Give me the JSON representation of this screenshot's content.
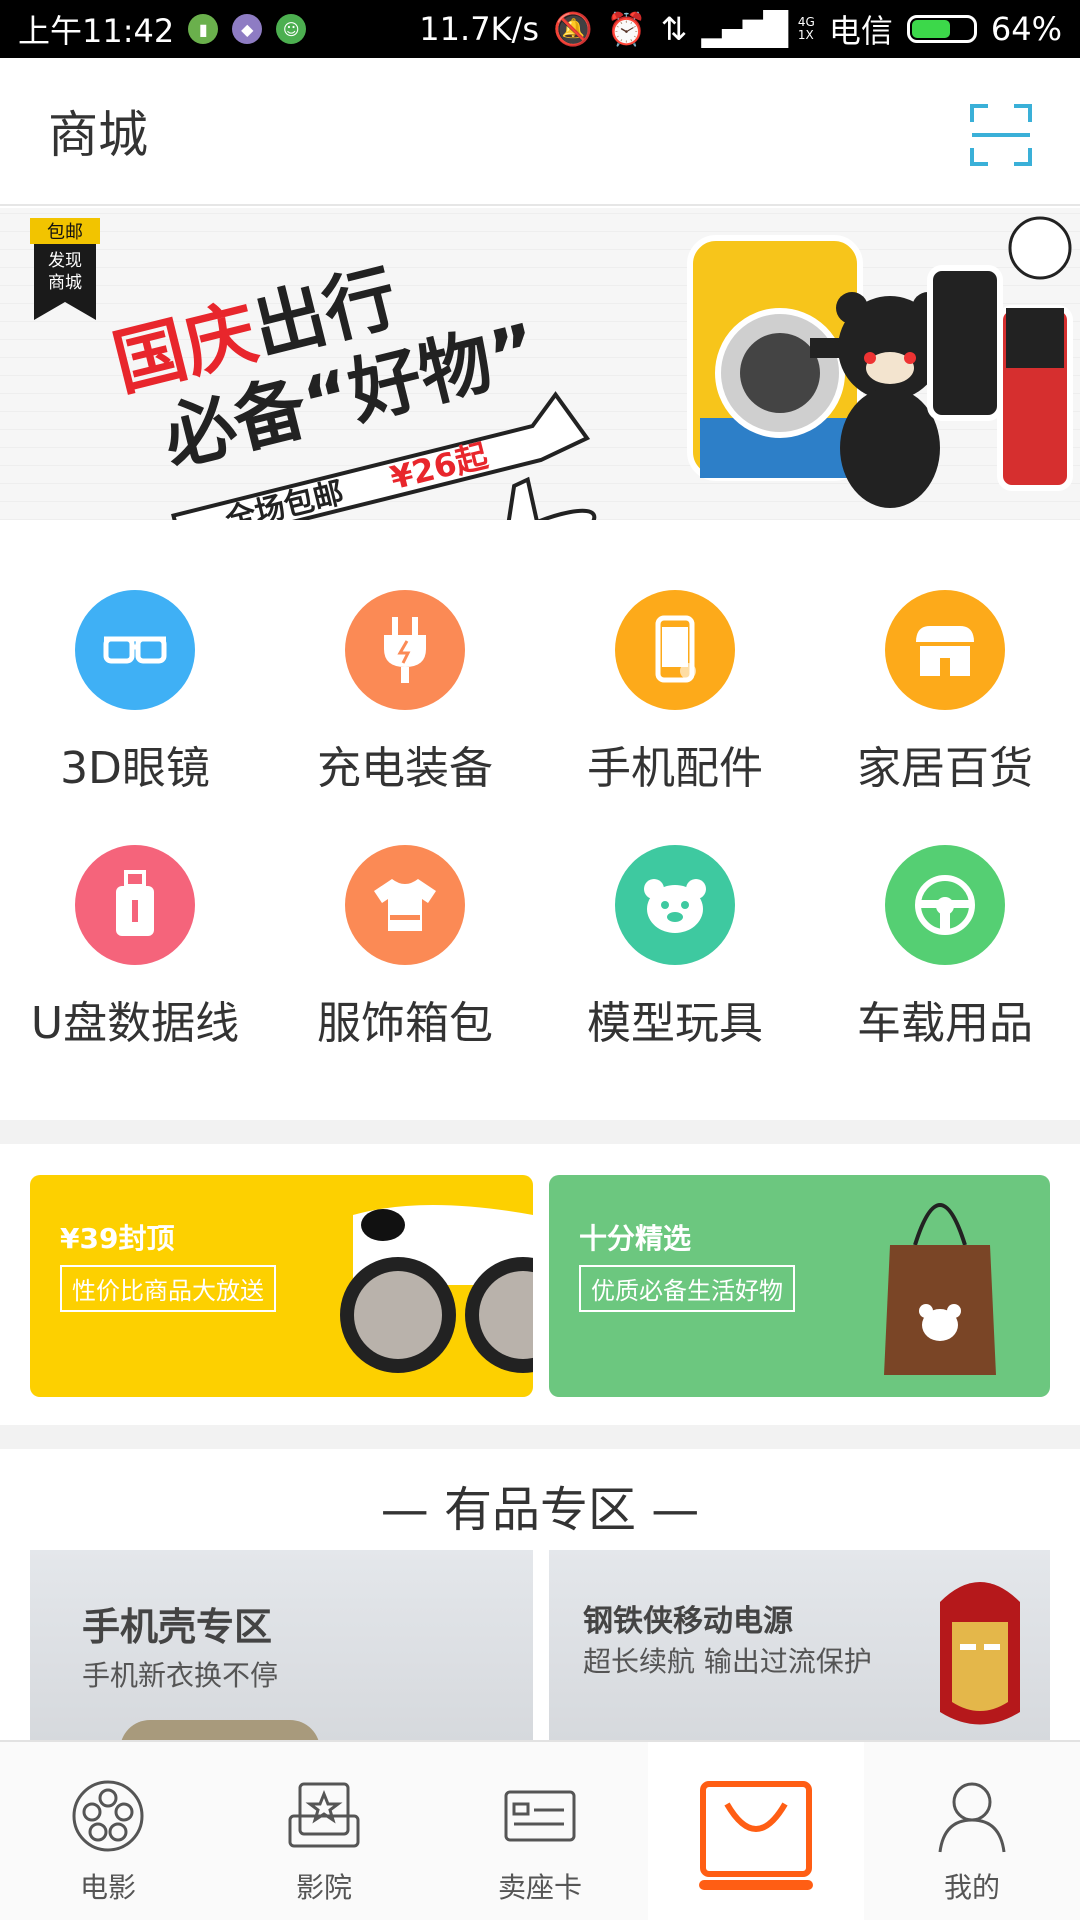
{
  "status_bar": {
    "time": "上午11:42",
    "net_speed": "11.7K/s",
    "network_small": "4G\n1X",
    "carrier": "电信",
    "battery": "64%",
    "battery_level": 0.64
  },
  "header": {
    "title": "商城",
    "scan_icon": "scan-icon"
  },
  "banner": {
    "tag_top": "包邮",
    "tag_line1": "发现",
    "tag_line2": "商城",
    "headline_red": "国庆",
    "headline_rest": "出行",
    "headline_line2": "必备“好物”",
    "ribbon_text": "全场包邮",
    "price_text": "¥26起"
  },
  "categories": [
    {
      "label": "3D眼镜",
      "icon": "3d-glasses-icon",
      "color": "#3fb0f5"
    },
    {
      "label": "充电装备",
      "icon": "plug-icon",
      "color": "#fb8a55"
    },
    {
      "label": "手机配件",
      "icon": "phone-icon",
      "color": "#fdaa1a"
    },
    {
      "label": "家居百货",
      "icon": "store-icon",
      "color": "#fdaa1a"
    },
    {
      "label": "U盘数据线",
      "icon": "usb-icon",
      "color": "#f5647b"
    },
    {
      "label": "服饰箱包",
      "icon": "tshirt-icon",
      "color": "#fb8a55"
    },
    {
      "label": "模型玩具",
      "icon": "bear-icon",
      "color": "#3ec9a0"
    },
    {
      "label": "车载用品",
      "icon": "steering-wheel-icon",
      "color": "#55cf73"
    }
  ],
  "promos": [
    {
      "title": "¥39封顶",
      "subtitle": "性价比商品大放送",
      "color": "#fdd000"
    },
    {
      "title": "十分精选",
      "subtitle": "优质必备生活好物",
      "color": "#6cc77f"
    }
  ],
  "section": {
    "title": "— 有品专区 —"
  },
  "zones": [
    {
      "title": "手机壳专区",
      "subtitle": "手机新衣换不停"
    },
    {
      "title": "钢铁侠移动电源",
      "subtitle": "超长续航 输出过流保护"
    }
  ],
  "tabs": [
    {
      "label": "电影",
      "icon": "film-reel-icon",
      "active": false
    },
    {
      "label": "影院",
      "icon": "cinema-seat-icon",
      "active": false
    },
    {
      "label": "卖座卡",
      "icon": "card-icon",
      "active": false
    },
    {
      "label": "",
      "icon": "shopping-bag-icon",
      "active": true
    },
    {
      "label": "我的",
      "icon": "user-icon",
      "active": false
    }
  ],
  "colors": {
    "accent": "#ff5e14",
    "scan": "#3ab0d8"
  }
}
